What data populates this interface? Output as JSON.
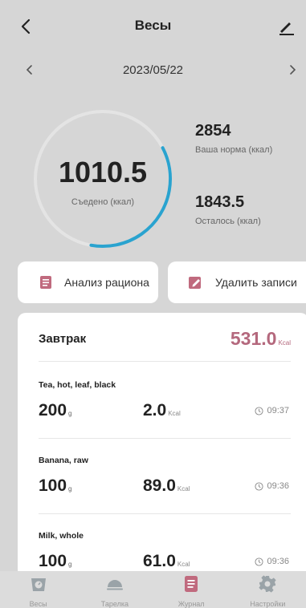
{
  "header": {
    "title": "Весы"
  },
  "date": "2023/05/22",
  "summary": {
    "eaten_value": "1010.5",
    "eaten_label": "Съедено (ккал)",
    "eaten_fraction": 0.354,
    "norm_value": "2854",
    "norm_label": "Ваша норма (ккал)",
    "left_value": "1843.5",
    "left_label": "Осталось (ккал)"
  },
  "actions": {
    "analysis_label": "Анализ рациона",
    "delete_label": "Удалить записи"
  },
  "meal": {
    "name": "Завтрак",
    "total": "531.0",
    "total_unit": "Kcal",
    "entries": [
      {
        "name": "Tea, hot, leaf, black",
        "grams": "200",
        "grams_unit": "g",
        "kcal": "2.0",
        "kcal_unit": "Kcal",
        "time": "09:37"
      },
      {
        "name": "Banana, raw",
        "grams": "100",
        "grams_unit": "g",
        "kcal": "89.0",
        "kcal_unit": "Kcal",
        "time": "09:36"
      },
      {
        "name": "Milk, whole",
        "grams": "100",
        "grams_unit": "g",
        "kcal": "61.0",
        "kcal_unit": "Kcal",
        "time": "09:36"
      }
    ]
  },
  "nav": {
    "tabs": [
      {
        "label": "Весы",
        "icon": "scale-icon"
      },
      {
        "label": "Тарелка",
        "icon": "plate-icon"
      },
      {
        "label": "Журнал",
        "icon": "journal-icon"
      },
      {
        "label": "Настройки",
        "icon": "gear-icon"
      }
    ]
  },
  "colors": {
    "background": "#d6d6d6",
    "accent_ring": "#2aa3cf",
    "ring_track": "#e4e4e4",
    "meal_total": "#b4687d",
    "icon_accent": "#c06a7e"
  }
}
